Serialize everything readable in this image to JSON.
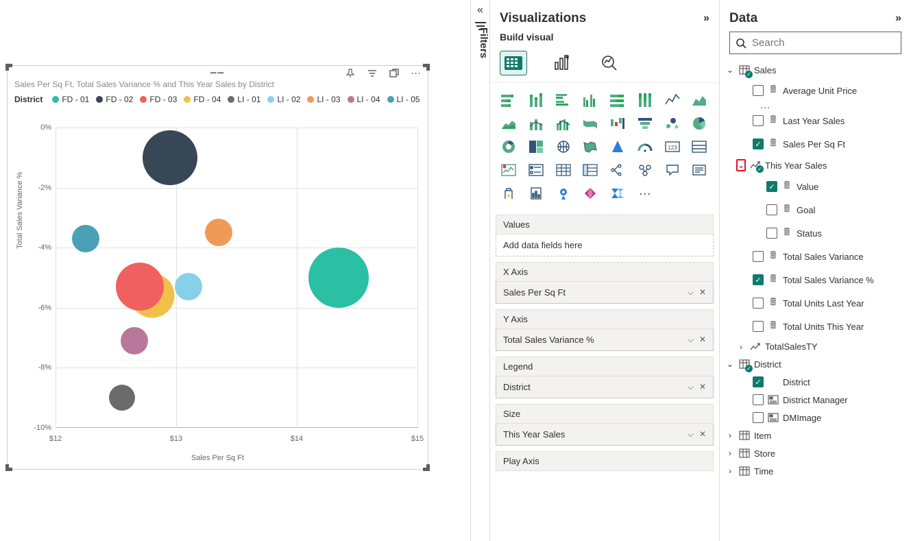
{
  "chart": {
    "title": "Sales Per Sq Ft, Total Sales Variance % and This Year Sales by District",
    "x_axis_label": "Sales Per Sq Ft",
    "y_axis_label": "Total Sales Variance %",
    "legend_title": "District",
    "legend": [
      {
        "label": "FD - 01",
        "color": "#2bbfa4"
      },
      {
        "label": "FD - 02",
        "color": "#384755"
      },
      {
        "label": "FD - 03",
        "color": "#f06060"
      },
      {
        "label": "FD - 04",
        "color": "#f0c148"
      },
      {
        "label": "LI - 01",
        "color": "#6b6b6b"
      },
      {
        "label": "LI - 02",
        "color": "#88d0e8"
      },
      {
        "label": "LI - 03",
        "color": "#f09a58"
      },
      {
        "label": "LI - 04",
        "color": "#b8789c"
      },
      {
        "label": "LI - 05",
        "color": "#4aa0b5"
      }
    ]
  },
  "chart_data": {
    "type": "scatter",
    "title": "Sales Per Sq Ft, Total Sales Variance % and This Year Sales by District",
    "xlabel": "Sales Per Sq Ft",
    "ylabel": "Total Sales Variance %",
    "xlim": [
      12,
      15
    ],
    "ylim": [
      -10,
      0
    ],
    "x_ticks": [
      "$12",
      "$13",
      "$14",
      "$15"
    ],
    "y_ticks": [
      "0%",
      "-2%",
      "-4%",
      "-6%",
      "-8%",
      "-10%"
    ],
    "series": [
      {
        "name": "FD - 01",
        "color": "#2bbfa4",
        "x": 14.35,
        "y": -5.0,
        "size": 88
      },
      {
        "name": "FD - 02",
        "color": "#384755",
        "x": 12.95,
        "y": -1.0,
        "size": 80
      },
      {
        "name": "FD - 03",
        "color": "#f06060",
        "x": 12.7,
        "y": -5.3,
        "size": 70
      },
      {
        "name": "FD - 04",
        "color": "#f0c148",
        "x": 12.8,
        "y": -5.6,
        "size": 65
      },
      {
        "name": "LI - 01",
        "color": "#6b6b6b",
        "x": 12.55,
        "y": -9.0,
        "size": 38
      },
      {
        "name": "LI - 02",
        "color": "#88d0e8",
        "x": 13.1,
        "y": -5.3,
        "size": 40
      },
      {
        "name": "LI - 03",
        "color": "#f09a58",
        "x": 13.35,
        "y": -3.5,
        "size": 40
      },
      {
        "name": "LI - 04",
        "color": "#b8789c",
        "x": 12.65,
        "y": -7.1,
        "size": 40
      },
      {
        "name": "LI - 05",
        "color": "#4aa0b5",
        "x": 12.25,
        "y": -3.7,
        "size": 40
      }
    ]
  },
  "filters_label": "Filters",
  "viz": {
    "header": "Visualizations",
    "sub": "Build visual",
    "wells": {
      "values": {
        "label": "Values",
        "placeholder": "Add data fields here"
      },
      "xaxis": {
        "label": "X Axis",
        "value": "Sales Per Sq Ft"
      },
      "yaxis": {
        "label": "Y Axis",
        "value": "Total Sales Variance %"
      },
      "legend": {
        "label": "Legend",
        "value": "District"
      },
      "size": {
        "label": "Size",
        "value": "This Year Sales"
      },
      "play": {
        "label": "Play Axis"
      }
    }
  },
  "data": {
    "header": "Data",
    "search_placeholder": "Search",
    "tables": {
      "sales": {
        "name": "Sales",
        "fields": {
          "avg_unit": "Average Unit Price",
          "last_year": "Last Year Sales",
          "per_sqft": "Sales Per Sq Ft",
          "this_year": "This Year Sales",
          "value": "Value",
          "goal": "Goal",
          "status": "Status",
          "tsv": "Total Sales Variance",
          "tsvp": "Total Sales Variance %",
          "tuly": "Total Units Last Year",
          "tuty": "Total Units This Year",
          "tsty": "TotalSalesTY"
        }
      },
      "district": {
        "name": "District",
        "fields": {
          "district": "District",
          "manager": "District Manager",
          "dmimage": "DMImage"
        }
      },
      "item": "Item",
      "store": "Store",
      "time": "Time"
    }
  }
}
